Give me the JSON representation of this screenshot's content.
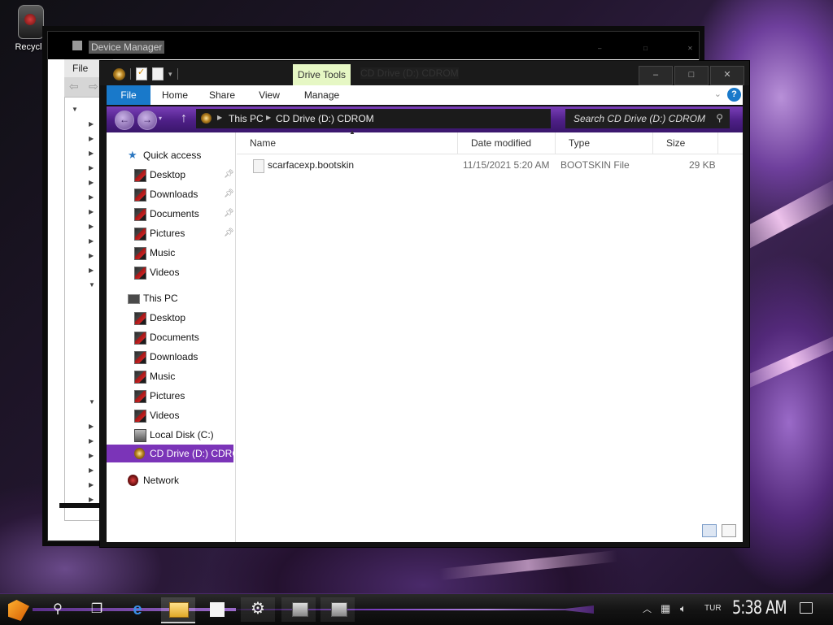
{
  "desktop": {
    "recycle_bin_label": "Recycle"
  },
  "device_manager": {
    "title": "Device Manager",
    "menu_file": "File"
  },
  "explorer": {
    "contextual_tab": "Drive Tools",
    "window_title": "CD Drive (D:) CDROM",
    "window_controls": [
      "–",
      "□",
      "✕"
    ],
    "ribbon_tabs": [
      "File",
      "Home",
      "Share",
      "View",
      "Manage"
    ],
    "breadcrumb": [
      "This PC",
      "CD Drive (D:) CDROM"
    ],
    "search_placeholder": "Search CD Drive (D:) CDROM",
    "nav_pane": {
      "quick_access": "Quick access",
      "quick_items": [
        "Desktop",
        "Downloads",
        "Documents",
        "Pictures",
        "Music",
        "Videos"
      ],
      "this_pc": "This PC",
      "pc_items": [
        "Desktop",
        "Documents",
        "Downloads",
        "Music",
        "Pictures",
        "Videos",
        "Local Disk (C:)",
        "CD Drive (D:) CDROM"
      ],
      "network": "Network",
      "selected": "CD Drive (D:) CDROM"
    },
    "columns": [
      "Name",
      "Date modified",
      "Type",
      "Size"
    ],
    "files": [
      {
        "name": "scarfacexp.bootskin",
        "date": "11/15/2021 5:20 AM",
        "type": "BOOTSKIN File",
        "size": "29 KB"
      }
    ]
  },
  "taskbar": {
    "language": "TUR",
    "time": "5:38 AM",
    "apps": [
      "start-icon",
      "search-icon",
      "task-view-icon",
      "edge-icon",
      "file-explorer-icon",
      "store-icon",
      "settings-icon",
      "device-manager-icon",
      "device-manager-icon"
    ],
    "accent": "#7b3fc0"
  }
}
